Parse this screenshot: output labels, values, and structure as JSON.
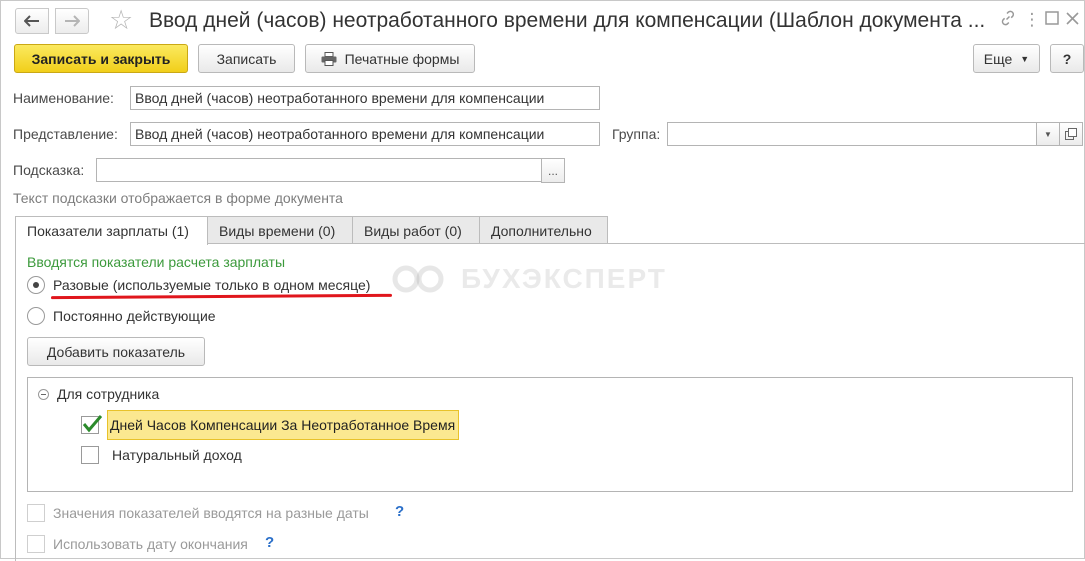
{
  "window": {
    "title": "Ввод дней (часов) неотработанного времени для компенсации (Шаблон документа ...",
    "back_icon": "arrow-left-icon",
    "forward_icon": "arrow-right-icon",
    "star_icon": "star-icon",
    "link_icon": "link-icon",
    "menu_icon": "more-vertical-icon",
    "maximize_icon": "maximize-icon",
    "close_icon": "close-icon"
  },
  "toolbar": {
    "save_close_label": "Записать и закрыть",
    "save_label": "Записать",
    "print_label": "Печатные формы",
    "print_icon": "printer-icon",
    "more_label": "Еще",
    "help_label": "?"
  },
  "form": {
    "name_label": "Наименование:",
    "name_value": "Ввод дней (часов) неотработанного времени для компенсации",
    "presentation_label": "Представление:",
    "presentation_value": "Ввод дней (часов) неотработанного времени для компенсации",
    "group_label": "Группа:",
    "group_value": "",
    "hint_label": "Подсказка:",
    "hint_value": "",
    "hint_button": "...",
    "hint_text": "Текст подсказки отображается в форме документа"
  },
  "tabs": [
    {
      "label": "Показатели зарплаты (1)",
      "active": true
    },
    {
      "label": "Виды времени (0)",
      "active": false
    },
    {
      "label": "Виды работ (0)",
      "active": false
    },
    {
      "label": "Дополнительно",
      "active": false
    }
  ],
  "indicators": {
    "section_title": "Вводятся показатели расчета зарплаты",
    "option_once": "Разовые (используемые только в одном месяце)",
    "option_permanent": "Постоянно действующие",
    "selected_option": "once",
    "add_button": "Добавить показатель",
    "tree_group": "Для сотрудника",
    "items": [
      {
        "label": "Дней Часов Компенсации За Неотработанное Время",
        "checked": true
      },
      {
        "label": "Натуральный доход",
        "checked": false
      }
    ]
  },
  "options": {
    "different_dates": "Значения показателей вводятся на разные даты",
    "use_end_date": "Использовать дату окончания",
    "help_mark": "?"
  },
  "watermark": "БУХЭКСПЕРТ",
  "colors": {
    "primary_button": "#f5d327",
    "section_title": "#3c9a3c",
    "underline": "#e0161c",
    "selection": "#fbe890"
  }
}
